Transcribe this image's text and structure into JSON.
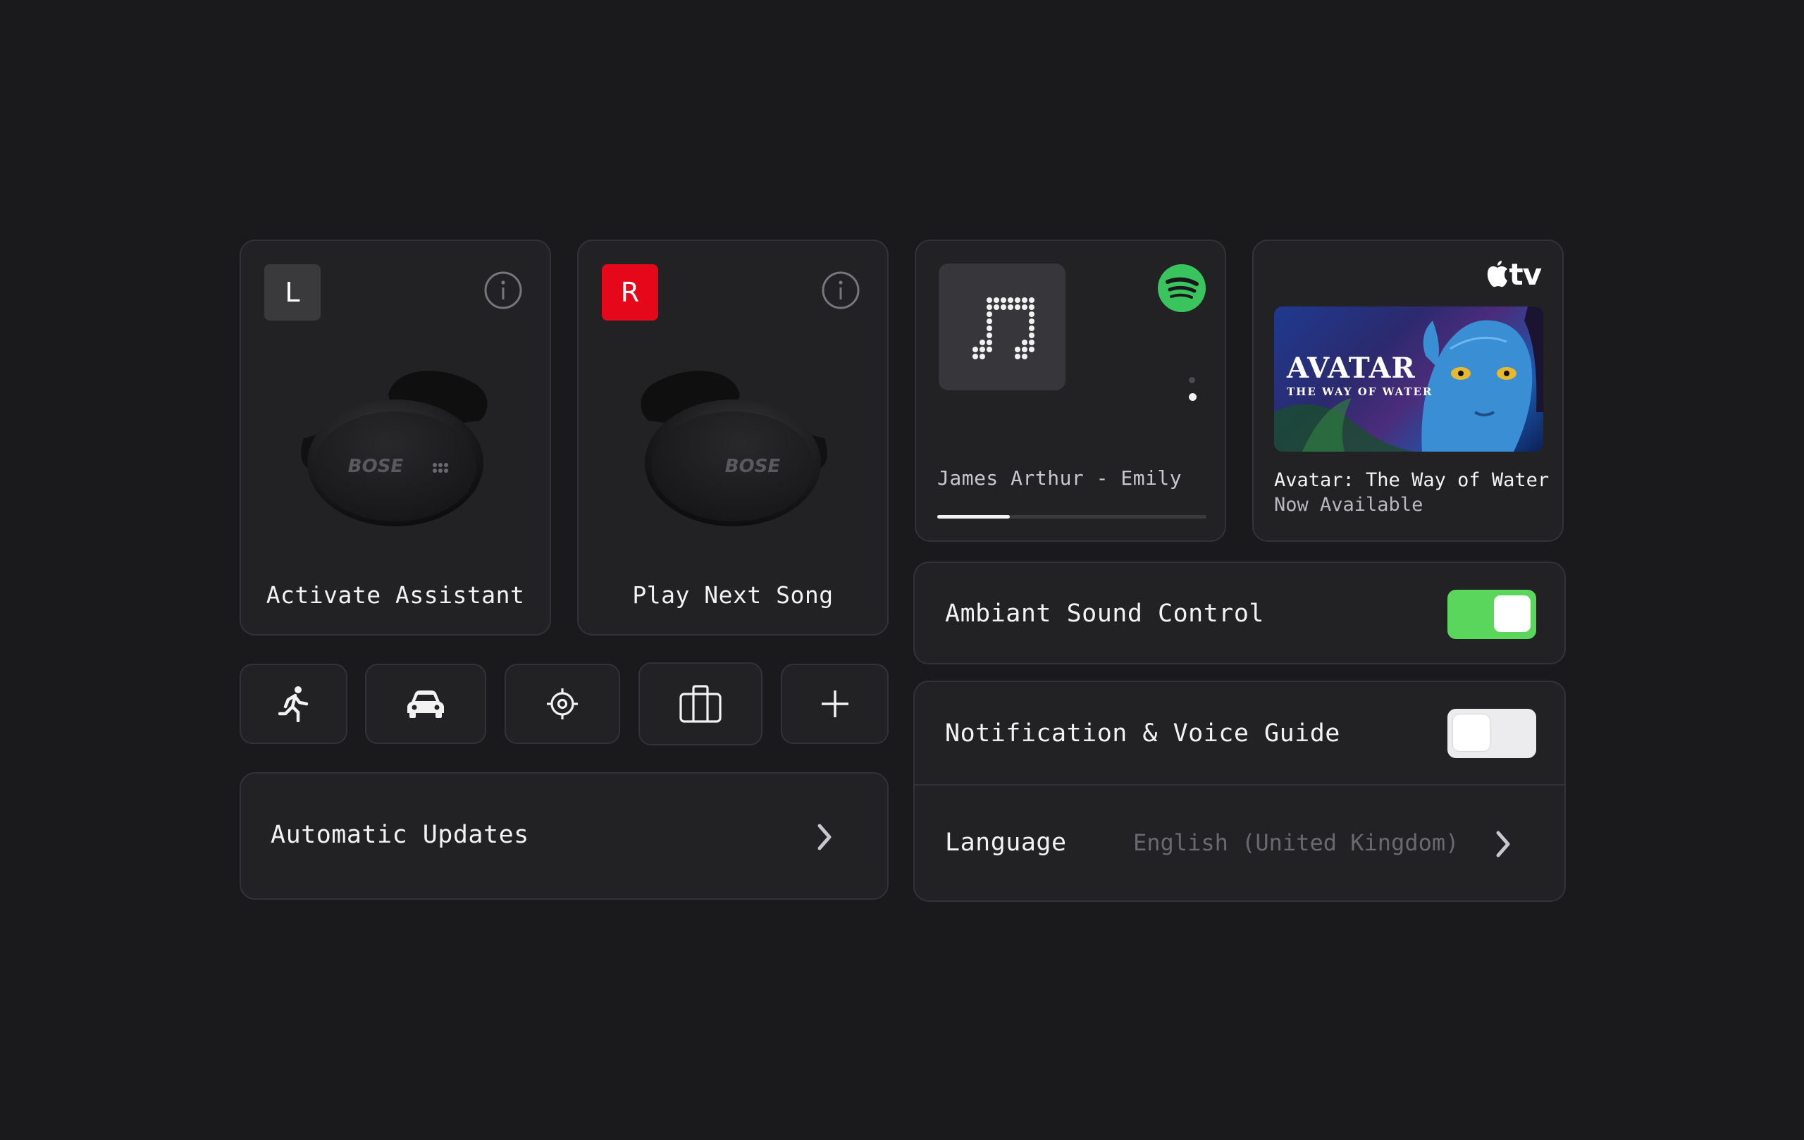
{
  "earbuds": {
    "left": {
      "badge": "L",
      "label": "Activate Assistant",
      "brand": "BOSE"
    },
    "right": {
      "badge": "R",
      "label": "Play Next Song",
      "brand": "BOSE"
    }
  },
  "modes": [
    {
      "icon": "running-icon"
    },
    {
      "icon": "car-icon"
    },
    {
      "icon": "target-icon"
    },
    {
      "icon": "briefcase-icon"
    },
    {
      "icon": "plus-icon"
    }
  ],
  "updates": {
    "label": "Automatic Updates"
  },
  "music": {
    "service_icon": "spotify-icon",
    "track": "James Arthur - Emily",
    "progress": 0.27,
    "page_dots": 2,
    "active_dot": 1
  },
  "appletv": {
    "logo_text": "tv",
    "poster_title": "AVATAR",
    "poster_subtitle": "THE WAY OF WATER",
    "title": "Avatar: The Way of Water",
    "subtitle": "Now Available"
  },
  "ambient": {
    "label": "Ambiant Sound Control",
    "enabled": true
  },
  "notification": {
    "label": "Notification & Voice Guide",
    "enabled": false
  },
  "language": {
    "label": "Language",
    "value": "English (United Kingdom)"
  },
  "colors": {
    "background": "#1a1a1c",
    "card": "#222225",
    "right_badge": "#e4081a",
    "left_badge": "#3a3a3d",
    "toggle_on": "#5ad65c",
    "toggle_off": "#ececef",
    "spotify": "#3ac45e"
  }
}
